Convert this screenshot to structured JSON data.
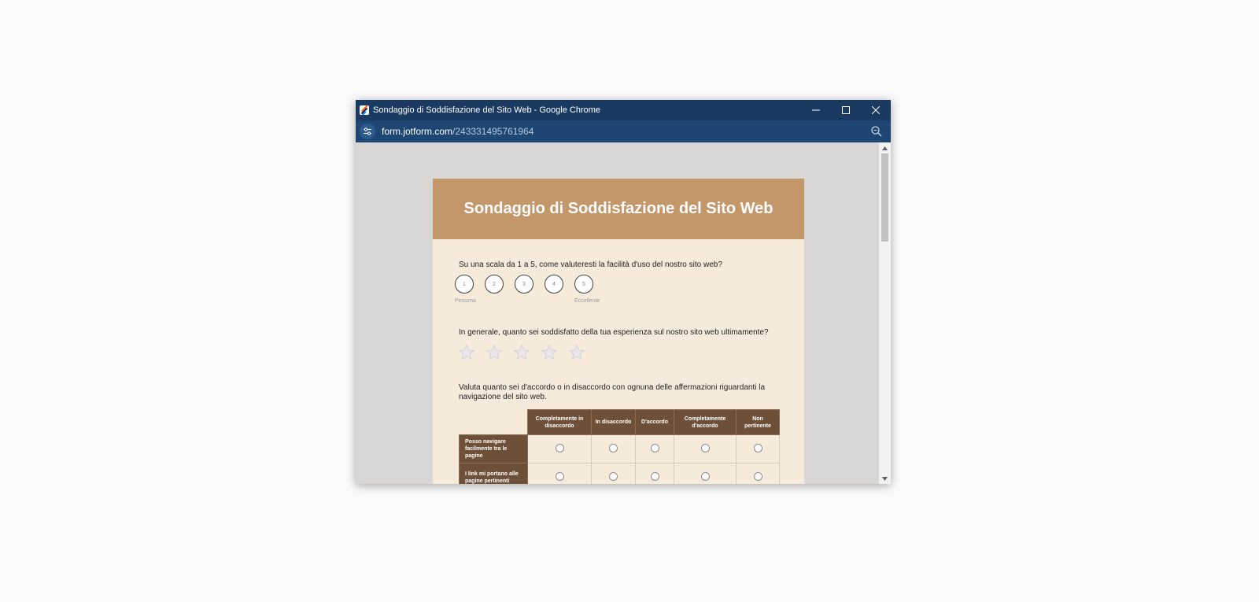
{
  "window": {
    "title": "Sondaggio di Soddisfazione del Sito Web - Google Chrome",
    "controls": [
      "minimize-icon",
      "maximize-icon",
      "close-icon"
    ]
  },
  "address_bar": {
    "domain": "form.jotform.com",
    "path": "/243331495761964",
    "site_icon": "tune-icon",
    "zoom_icon": "zoom-icon"
  },
  "form": {
    "title": "Sondaggio di Soddisfazione del Sito Web",
    "q1": {
      "text": "Su una scala da 1 a 5, come valuteresti la facilità d'uso del nostro sito web?",
      "options": [
        "1",
        "2",
        "3",
        "4",
        "5"
      ],
      "low_label": "Pessima",
      "high_label": "Eccellente"
    },
    "q2": {
      "text": "In generale, quanto sei soddisfatto della tua esperienza sul nostro sito web ultimamente?",
      "stars_total": 5,
      "stars_selected": 0
    },
    "q3": {
      "text": "Valuta quanto sei d'accordo o in disaccordo con ognuna delle affermazioni riguardanti la navigazione del sito web.",
      "columns": [
        "Completamente in disaccordo",
        "In disaccordo",
        "D'accordo",
        "Completamente d'accordo",
        "Non pertinente"
      ],
      "rows": [
        "Posso navigare facilmente tra le pagine",
        "I link mi portano alle pagine pertinenti"
      ]
    }
  },
  "colors": {
    "titlebar": "#1b3a61",
    "addressbar": "#1e4673",
    "header": "#c4976a",
    "card": "#f6eadb",
    "matrix_header": "#6e5039"
  }
}
